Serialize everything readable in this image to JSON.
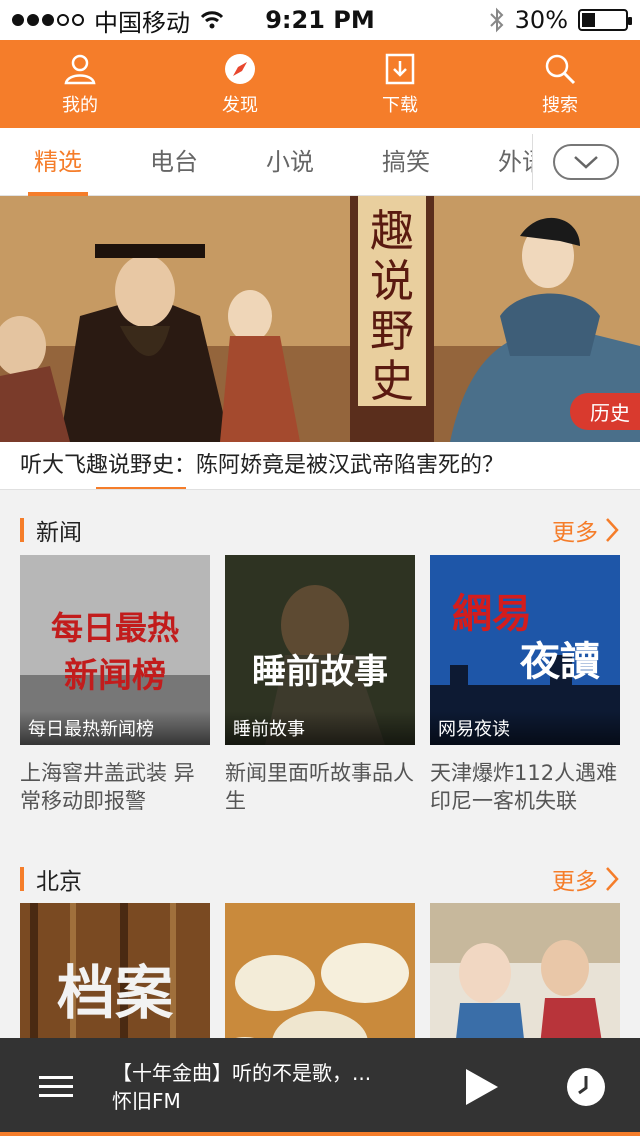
{
  "status": {
    "carrier": "中国移动",
    "time": "9:21 PM",
    "battery": "30%",
    "battery_level": 0.3
  },
  "topnav": [
    {
      "label": "我的",
      "icon": "person-icon"
    },
    {
      "label": "发现",
      "icon": "compass-icon"
    },
    {
      "label": "下载",
      "icon": "download-icon"
    },
    {
      "label": "搜索",
      "icon": "search-icon"
    }
  ],
  "tabs": [
    "精选",
    "电台",
    "小说",
    "搞笑",
    "外语"
  ],
  "banner": {
    "tag": "历史",
    "caption": "听大飞趣说野史：陈阿娇竟是被汉武帝陷害死的？",
    "art_text": "趣说野史"
  },
  "sections": [
    {
      "title": "新闻",
      "more": "更多",
      "cards": [
        {
          "label": "每日最热新闻榜",
          "art_line1": "每日最热",
          "art_line2": "新闻榜",
          "desc": "上海窨井盖武装 异常移动即报警"
        },
        {
          "label": "睡前故事",
          "art_line1": "睡前故事",
          "desc": "新闻里面听故事品人生"
        },
        {
          "label": "网易夜读",
          "art_line1": "網易",
          "art_line2": "夜讀",
          "desc": "天津爆炸112人遇难印尼一客机失联"
        }
      ]
    },
    {
      "title": "北京",
      "more": "更多",
      "cards": [
        {
          "label": "",
          "art_line1": "档案"
        },
        {
          "label": ""
        },
        {
          "label": ""
        }
      ]
    }
  ],
  "player": {
    "line1": "【十年金曲】听的不是歌，...",
    "line2": "怀旧FM"
  },
  "colors": {
    "accent": "#f57d2a",
    "player_bg": "#333333",
    "tag_red": "#d93a2e"
  }
}
